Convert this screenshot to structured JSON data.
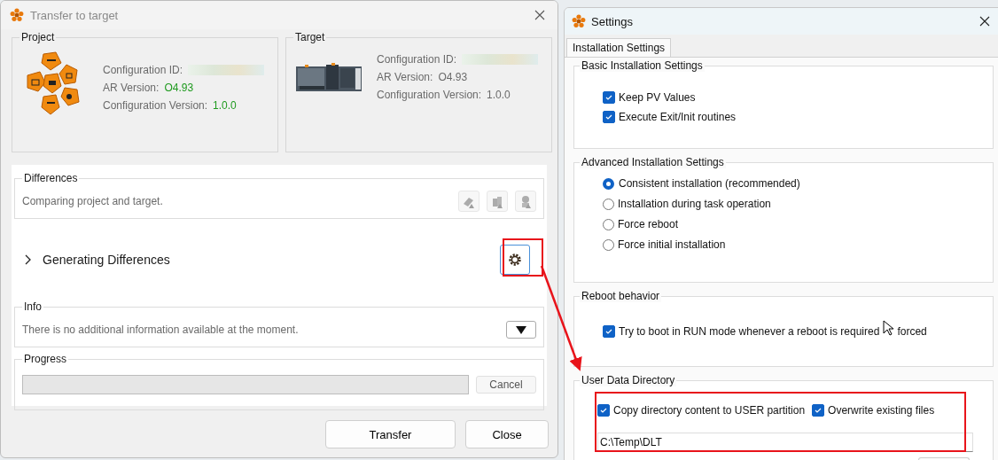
{
  "transfer_dialog": {
    "title": "Transfer to target",
    "panels": [
      {
        "label": "Project",
        "kind": "project",
        "fields": [
          {
            "label": "Configuration ID:",
            "kind": "redacted"
          },
          {
            "label": "AR Version:",
            "kind": "text",
            "value": "O4.93",
            "highlight": true
          },
          {
            "label": "Configuration Version:",
            "kind": "text",
            "value": "1.0.0",
            "highlight": true
          }
        ]
      },
      {
        "label": "Target",
        "kind": "target",
        "fields": [
          {
            "label": "Configuration ID:",
            "kind": "redacted"
          },
          {
            "label": "AR Version:",
            "kind": "text",
            "value": "O4.93",
            "highlight": false
          },
          {
            "label": "Configuration Version:",
            "kind": "text",
            "value": "1.0.0",
            "highlight": false
          }
        ]
      }
    ],
    "differences": {
      "label": "Differences",
      "status": "Comparing project and target.",
      "tools": [
        {
          "kind": "software",
          "disabled": true
        },
        {
          "kind": "hardware",
          "disabled": true
        },
        {
          "kind": "user",
          "disabled": true
        }
      ]
    },
    "generating": {
      "text": "Generating Differences",
      "expanded": false
    },
    "info": {
      "label": "Info",
      "text": "There is no additional information available at the moment."
    },
    "progress": {
      "label": "Progress",
      "level": 0,
      "cancel": "Cancel"
    },
    "buttons": [
      "Transfer",
      "Close"
    ]
  },
  "settings_dialog": {
    "title": "Settings",
    "tabs": [
      {
        "label": "Installation Settings",
        "selected": true
      }
    ],
    "groups": [
      {
        "title": "Basic Installation Settings",
        "kind": "checks",
        "items": [
          {
            "label": "Keep PV Values",
            "checked": true
          },
          {
            "label": "Execute Exit/Init routines",
            "checked": true
          }
        ]
      },
      {
        "title": "Advanced Installation Settings",
        "kind": "radios",
        "items": [
          {
            "label": "Consistent installation (recommended)",
            "selected": true
          },
          {
            "label": "Installation during task operation",
            "selected": false
          },
          {
            "label": "Force reboot",
            "selected": false
          },
          {
            "label": "Force initial installation",
            "selected": false
          }
        ]
      },
      {
        "title": "Reboot behavior",
        "kind": "reboot",
        "items": [
          {
            "label": "Try to boot in RUN mode whenever a reboot is required",
            "after_cursor": "forced",
            "checked": true
          }
        ]
      },
      {
        "title": "User Data Directory",
        "kind": "userdata",
        "items": [
          {
            "label": "Copy directory content to USER partition",
            "checked": true
          },
          {
            "label": "Overwrite existing files",
            "checked": true
          }
        ],
        "path": "C:\\Temp\\DLT"
      }
    ]
  }
}
